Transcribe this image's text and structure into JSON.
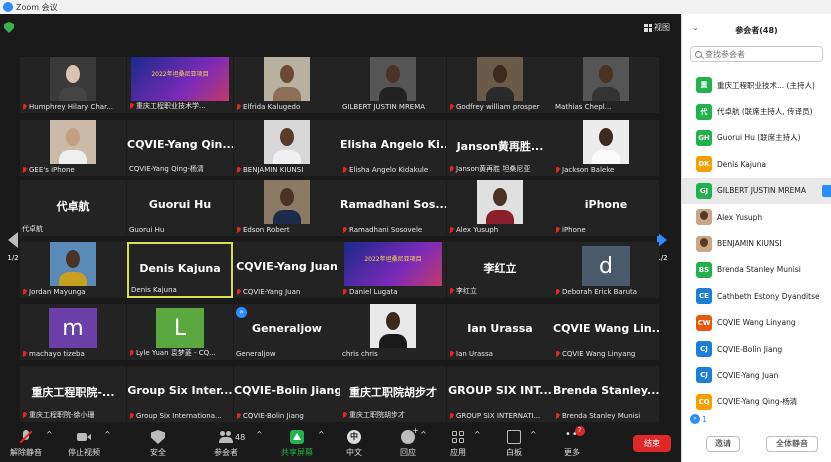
{
  "window": {
    "title": "Zoom 会议"
  },
  "view_button": "视图",
  "pager": {
    "left": "1/2",
    "right": "1/2"
  },
  "tiles": [
    {
      "label": "Humphrey Hilary Char...",
      "big": "",
      "muted": true,
      "kind": "photo",
      "bg": "#3a3a3a",
      "skin": "#d8c4b0",
      "shirt": "#444"
    },
    {
      "label": "重庆工程职业技术学...",
      "big": "",
      "muted": true,
      "kind": "banner"
    },
    {
      "label": "Elfrida Kalugedo",
      "big": "",
      "muted": true,
      "kind": "photo",
      "bg": "#b8b0a0",
      "skin": "#6b4a35",
      "shirt": "#8a6f58"
    },
    {
      "label": "GILBERT JUSTIN MREMA",
      "big": "",
      "muted": false,
      "kind": "photo",
      "bg": "#555",
      "skin": "#4a3224",
      "shirt": "#222"
    },
    {
      "label": "Godfrey william prosper",
      "big": "",
      "muted": true,
      "kind": "photo",
      "bg": "#6a5a4a",
      "skin": "#3d2a1f",
      "shirt": "#2a2a2a"
    },
    {
      "label": "Mathias Chepl...",
      "big": "",
      "muted": false,
      "kind": "photo",
      "bg": "#555",
      "skin": "#4a3224",
      "shirt": "#333"
    },
    {
      "label": "GEE's iPhone",
      "big": "",
      "muted": true,
      "kind": "photo",
      "bg": "#c9bba8",
      "skin": "#c4a080",
      "shirt": "#eee"
    },
    {
      "label": "CQVIE-Yang Qing-杨清",
      "big": "CQVIE-Yang Qin...",
      "muted": false,
      "kind": "text"
    },
    {
      "label": "BENJAMIN KIUNSI",
      "big": "",
      "muted": true,
      "kind": "photo",
      "bg": "#d8d8d8",
      "skin": "#5a3a28",
      "shirt": "#f0f0f0"
    },
    {
      "label": "Elisha Angelo Kidakule",
      "big": "Elisha Angelo Ki...",
      "muted": true,
      "kind": "text"
    },
    {
      "label": "Janson黄再胜 坦桑尼亚",
      "big": "Janson黄再胜...",
      "muted": true,
      "kind": "text"
    },
    {
      "label": "Jackson Baleke",
      "big": "",
      "muted": true,
      "kind": "photo",
      "bg": "#ececec",
      "skin": "#3d2a1f",
      "shirt": "#fafafa"
    },
    {
      "label": "代卓航",
      "big": "代卓航",
      "muted": false,
      "kind": "text"
    },
    {
      "label": "Guorui Hu",
      "big": "Guorui Hu",
      "muted": false,
      "kind": "text"
    },
    {
      "label": "Edson Robert",
      "big": "",
      "muted": true,
      "kind": "photo",
      "bg": "#8a7a66",
      "skin": "#4a3224",
      "shirt": "#1e2a4a"
    },
    {
      "label": "Ramadhani Sosovele",
      "big": "Ramadhani Sos...",
      "muted": true,
      "kind": "text"
    },
    {
      "label": "Alex Yusuph",
      "big": "",
      "muted": true,
      "kind": "photo",
      "bg": "#e0e0e0",
      "skin": "#4a3224",
      "shirt": "#8a1e2a"
    },
    {
      "label": "iPhone",
      "big": "iPhone",
      "muted": true,
      "kind": "text"
    },
    {
      "label": "Jordan Mayunga",
      "big": "",
      "muted": true,
      "kind": "photo",
      "bg": "#5a8ab8",
      "skin": "#4a3224",
      "shirt": "#c8a020"
    },
    {
      "label": "Denis Kajuna",
      "big": "Denis Kajuna",
      "muted": false,
      "kind": "text",
      "active": true
    },
    {
      "label": "CQVIE-Yang Juan",
      "big": "CQVIE-Yang Juan",
      "muted": true,
      "kind": "text"
    },
    {
      "label": "Daniel Lugata",
      "big": "",
      "muted": true,
      "kind": "banner"
    },
    {
      "label": "李红立",
      "big": "李红立",
      "muted": true,
      "kind": "text"
    },
    {
      "label": "Deborah Erick Baruta",
      "big": "",
      "muted": true,
      "kind": "avatar",
      "letter": "d",
      "color": "#4a5a6a"
    },
    {
      "label": "machayo tizeba",
      "big": "",
      "muted": true,
      "kind": "avatar",
      "letter": "m",
      "color": "#6a3fa8"
    },
    {
      "label": "Lyle Yuan 袁梦菱 - CQ...",
      "big": "",
      "muted": true,
      "kind": "avatar",
      "letter": "L",
      "color": "#5aa83f"
    },
    {
      "label": "Generaljow",
      "big": "Generaljow",
      "muted": false,
      "kind": "text",
      "badge": true
    },
    {
      "label": "chris chris",
      "big": "",
      "muted": false,
      "kind": "photo",
      "bg": "#e8e8e8",
      "skin": "#3d2a1f",
      "shirt": "#1a1a1a"
    },
    {
      "label": "Ian Urassa",
      "big": "Ian Urassa",
      "muted": true,
      "kind": "text"
    },
    {
      "label": "CQVIE Wang Linyang",
      "big": "CQVIE Wang Lin...",
      "muted": true,
      "kind": "text"
    },
    {
      "label": "重庆工程职院-徐小珊",
      "big": "重庆工程职院-...",
      "muted": true,
      "kind": "text"
    },
    {
      "label": "Group Six Internationa...",
      "big": "Group Six Inter...",
      "muted": true,
      "kind": "text"
    },
    {
      "label": "CQVIE-Bolin Jiang",
      "big": "CQVIE-Bolin Jiang",
      "muted": true,
      "kind": "text"
    },
    {
      "label": "重庆工职院胡步才",
      "big": "重庆工职院胡步才",
      "muted": true,
      "kind": "text"
    },
    {
      "label": "GROUP SIX INTERNATI...",
      "big": "GROUP SIX INT...",
      "muted": true,
      "kind": "text"
    },
    {
      "label": "Brenda Stanley Munisi",
      "big": "Brenda Stanley...",
      "muted": true,
      "kind": "text"
    }
  ],
  "banner_text": "2022年坦桑尼亚项目",
  "toolbar": {
    "mute": "解除静音",
    "video": "停止视频",
    "security": "安全",
    "participants": "参会者",
    "participants_count": "48",
    "share": "共享屏幕",
    "lang": "中文",
    "lang_glyph": "中",
    "reactions": "回应",
    "apps": "应用",
    "whiteboard": "白板",
    "more": "更多",
    "more_badge": "7",
    "end": "结束"
  },
  "panel": {
    "title": "参会者(48)",
    "search_placeholder": "查找参会者",
    "participants": [
      {
        "initials": "重",
        "color": "#22b14c",
        "name": "重庆工程职业技术... (主持人)"
      },
      {
        "initials": "代",
        "color": "#22b14c",
        "name": "代卓航 (联席主持人, 传译员)"
      },
      {
        "initials": "GH",
        "color": "#22b14c",
        "name": "Guorui Hu (联席主持人)"
      },
      {
        "initials": "DK",
        "color": "#f59f00",
        "name": "Denis Kajuna"
      },
      {
        "initials": "GJ",
        "color": "#22b14c",
        "name": "GILBERT JUSTIN MREMA",
        "selected": true
      },
      {
        "initials": "",
        "color": "",
        "name": "Alex Yusuph",
        "photo": true
      },
      {
        "initials": "",
        "color": "",
        "name": "BENJAMIN KIUNSI",
        "photo": true
      },
      {
        "initials": "BS",
        "color": "#22b14c",
        "name": "Brenda Stanley Munisi"
      },
      {
        "initials": "CE",
        "color": "#1c7ed6",
        "name": "Cathbeth Estony Dyanditse"
      },
      {
        "initials": "CW",
        "color": "#e8590c",
        "name": "CQVIE Wang Linyang"
      },
      {
        "initials": "CJ",
        "color": "#1c7ed6",
        "name": "CQVIE-Bolin Jiang"
      },
      {
        "initials": "CJ",
        "color": "#1c7ed6",
        "name": "CQVIE-Yang Juan"
      },
      {
        "initials": "CQ",
        "color": "#f59f00",
        "name": "CQVIE-Yang Qing-杨清"
      }
    ],
    "more_count": "1",
    "invite": "邀请",
    "mute_all": "全体静音"
  }
}
